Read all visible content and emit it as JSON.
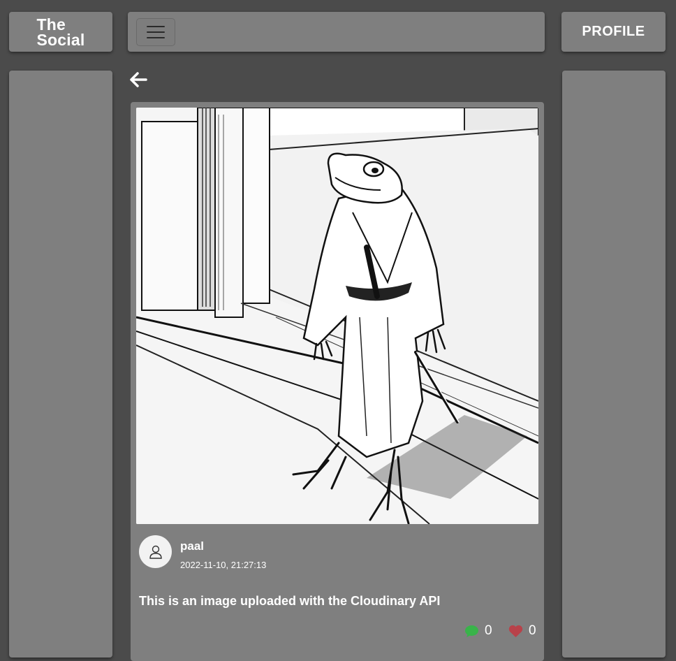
{
  "header": {
    "logo_line1": "The",
    "logo_line2": "Social",
    "menu_icon": "hamburger-icon",
    "profile_label": "PROFILE"
  },
  "navigation": {
    "back_icon": "arrow-left-icon"
  },
  "post": {
    "image_icon": "frog-samurai-illustration",
    "author": "paal",
    "timestamp": "2022-11-10, 21:27:13",
    "caption": "This is an image uploaded with the Cloudinary API",
    "comments": {
      "icon": "comment-icon",
      "count": "0",
      "color": "#39b34a"
    },
    "likes": {
      "icon": "heart-icon",
      "count": "0",
      "color": "#b8424a"
    }
  },
  "colors": {
    "background": "#4b4b4b",
    "panel": "#7f7f7f",
    "text": "#ffffff"
  }
}
